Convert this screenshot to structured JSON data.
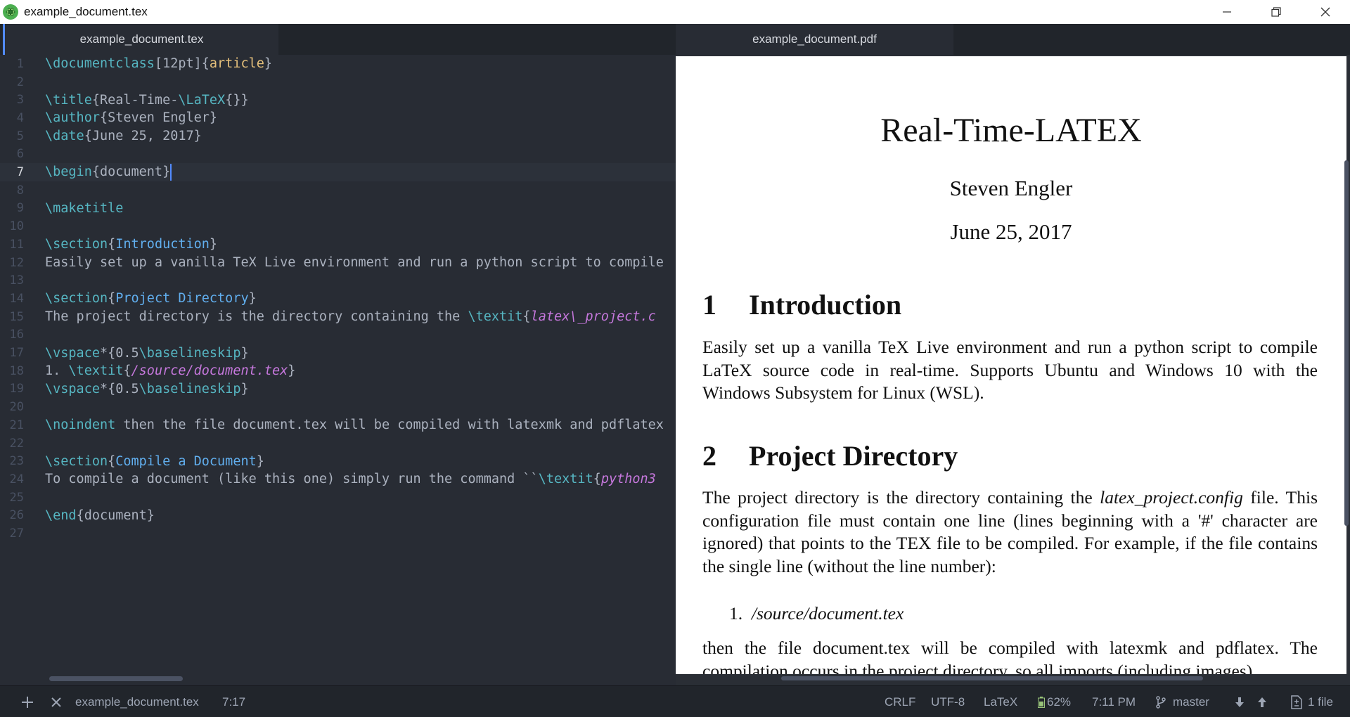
{
  "window": {
    "title": "example_document.tex"
  },
  "tabs": {
    "left": "example_document.tex",
    "right": "example_document.pdf"
  },
  "editor": {
    "lines": [
      {
        "n": "1",
        "parts": [
          {
            "t": "\\documentclass",
            "c": "cmd"
          },
          {
            "t": "[12pt]",
            "c": "br"
          },
          {
            "t": "{",
            "c": "br"
          },
          {
            "t": "article",
            "c": "arg"
          },
          {
            "t": "}",
            "c": "br"
          }
        ]
      },
      {
        "n": "2",
        "parts": []
      },
      {
        "n": "3",
        "parts": [
          {
            "t": "\\title",
            "c": "cmd"
          },
          {
            "t": "{Real-Time-",
            "c": "br"
          },
          {
            "t": "\\LaTeX",
            "c": "cmd"
          },
          {
            "t": "{}}",
            "c": "br"
          }
        ]
      },
      {
        "n": "4",
        "parts": [
          {
            "t": "\\author",
            "c": "cmd"
          },
          {
            "t": "{Steven Engler}",
            "c": "br"
          }
        ]
      },
      {
        "n": "5",
        "parts": [
          {
            "t": "\\date",
            "c": "cmd"
          },
          {
            "t": "{June 25, 2017}",
            "c": "br"
          }
        ]
      },
      {
        "n": "6",
        "parts": []
      },
      {
        "n": "7",
        "current": true,
        "parts": [
          {
            "t": "\\begin",
            "c": "cmd"
          },
          {
            "t": "{document}",
            "c": "br"
          }
        ]
      },
      {
        "n": "8",
        "parts": []
      },
      {
        "n": "9",
        "parts": [
          {
            "t": "\\maketitle",
            "c": "cmd"
          }
        ]
      },
      {
        "n": "10",
        "parts": []
      },
      {
        "n": "11",
        "parts": [
          {
            "t": "\\section",
            "c": "cmd"
          },
          {
            "t": "{",
            "c": "br"
          },
          {
            "t": "Introduction",
            "c": "sec"
          },
          {
            "t": "}",
            "c": "br"
          }
        ]
      },
      {
        "n": "12",
        "parts": [
          {
            "t": "Easily set up a vanilla TeX Live environment and run a python script to compile",
            "c": "br"
          }
        ]
      },
      {
        "n": "13",
        "parts": []
      },
      {
        "n": "14",
        "parts": [
          {
            "t": "\\section",
            "c": "cmd"
          },
          {
            "t": "{",
            "c": "br"
          },
          {
            "t": "Project Directory",
            "c": "sec"
          },
          {
            "t": "}",
            "c": "br"
          }
        ]
      },
      {
        "n": "15",
        "parts": [
          {
            "t": "The project directory is the directory containing the ",
            "c": "br"
          },
          {
            "t": "\\textit",
            "c": "cmd"
          },
          {
            "t": "{",
            "c": "br"
          },
          {
            "t": "latex\\_project.c",
            "c": "it"
          }
        ]
      },
      {
        "n": "16",
        "parts": []
      },
      {
        "n": "17",
        "parts": [
          {
            "t": "\\vspace",
            "c": "cmd"
          },
          {
            "t": "*{0.5",
            "c": "br"
          },
          {
            "t": "\\baselineskip",
            "c": "cmd"
          },
          {
            "t": "}",
            "c": "br"
          }
        ]
      },
      {
        "n": "18",
        "parts": [
          {
            "t": "1. ",
            "c": "br"
          },
          {
            "t": "\\textit",
            "c": "cmd"
          },
          {
            "t": "{",
            "c": "br"
          },
          {
            "t": "/source/document.tex",
            "c": "it"
          },
          {
            "t": "}",
            "c": "br"
          }
        ]
      },
      {
        "n": "19",
        "parts": [
          {
            "t": "\\vspace",
            "c": "cmd"
          },
          {
            "t": "*{0.5",
            "c": "br"
          },
          {
            "t": "\\baselineskip",
            "c": "cmd"
          },
          {
            "t": "}",
            "c": "br"
          }
        ]
      },
      {
        "n": "20",
        "parts": []
      },
      {
        "n": "21",
        "parts": [
          {
            "t": "\\noindent",
            "c": "cmd"
          },
          {
            "t": " then the file document.tex will be compiled with latexmk and pdflatex",
            "c": "br"
          }
        ]
      },
      {
        "n": "22",
        "parts": []
      },
      {
        "n": "23",
        "parts": [
          {
            "t": "\\section",
            "c": "cmd"
          },
          {
            "t": "{",
            "c": "br"
          },
          {
            "t": "Compile a Document",
            "c": "sec"
          },
          {
            "t": "}",
            "c": "br"
          }
        ]
      },
      {
        "n": "24",
        "parts": [
          {
            "t": "To compile a document (like this one) simply run the command ``",
            "c": "br"
          },
          {
            "t": "\\textit",
            "c": "cmd"
          },
          {
            "t": "{",
            "c": "br"
          },
          {
            "t": "python3",
            "c": "it"
          }
        ]
      },
      {
        "n": "25",
        "parts": []
      },
      {
        "n": "26",
        "parts": [
          {
            "t": "\\end",
            "c": "cmd"
          },
          {
            "t": "{document}",
            "c": "br"
          }
        ]
      },
      {
        "n": "27",
        "parts": []
      }
    ]
  },
  "pdf": {
    "title": "Real-Time-LATEX",
    "author": "Steven Engler",
    "date": "June 25, 2017",
    "sec1_num": "1",
    "sec1_title": "Introduction",
    "sec1_text": "Easily set up a vanilla TeX Live environment and run a python script to compile LaTeX source code in real-time. Supports Ubuntu and Windows 10 with the Windows Subsystem for Linux (WSL).",
    "sec2_num": "2",
    "sec2_title": "Project Directory",
    "sec2_text_a": "The project directory is the directory containing the ",
    "sec2_text_italic": "latex_project.config",
    "sec2_text_b": " file. This configuration file must contain one line (lines beginning with a '#' character are ignored) that points to the TEX file to be compiled. For example, if the file contains the single line (without the line number):",
    "list_num": "1.",
    "list_item": "/source/document.tex",
    "after_list": "then the file document.tex will be compiled with latexmk and pdflatex. The compilation occurs in the project directory, so all imports (including images)"
  },
  "statusbar": {
    "filename": "example_document.tex",
    "cursor_pos": "7:17",
    "line_ending": "CRLF",
    "encoding": "UTF-8",
    "grammar": "LaTeX",
    "battery": "62%",
    "time": "7:11 PM",
    "branch": "master",
    "files": "1 file"
  },
  "colors": {
    "accent": "#528bff",
    "cmd": "#56b6c2",
    "arg": "#e5c07b",
    "section": "#61afef",
    "italic": "#c678dd"
  }
}
